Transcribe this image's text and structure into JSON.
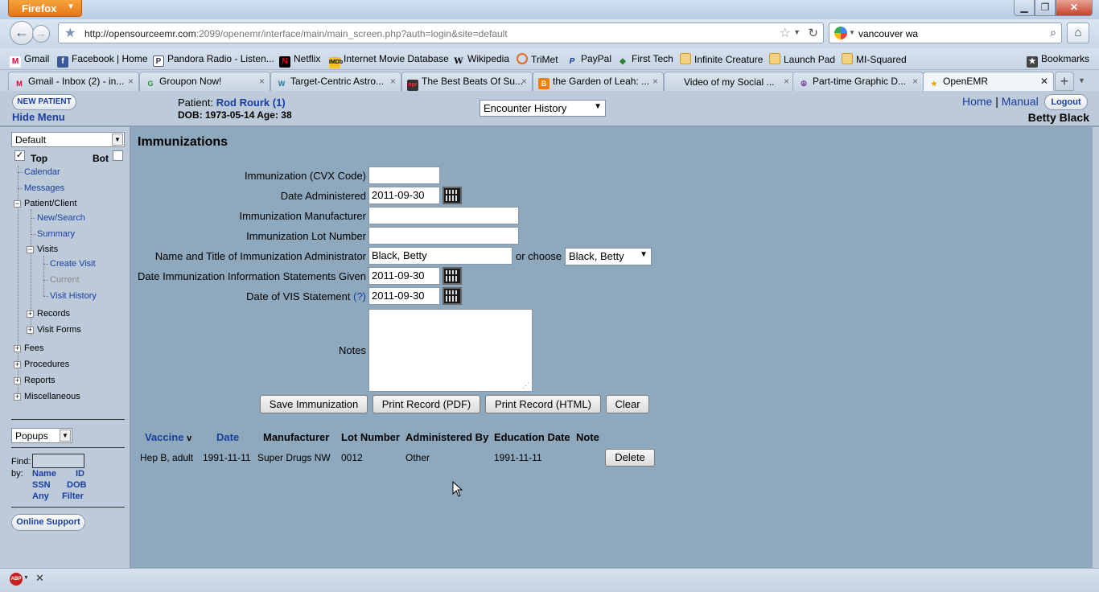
{
  "browser": {
    "app_button": "Firefox",
    "url_host": "http://opensourceemr.com",
    "url_rest": ":2099/openemr/interface/main/main_screen.php?auth=login&site=default",
    "search_value": "vancouver wa",
    "bookmarks": [
      "Gmail",
      "Facebook | Home",
      "Pandora Radio - Listen...",
      "Netflix",
      "Internet Movie Database",
      "Wikipedia",
      "TriMet",
      "PayPal",
      "First Tech",
      "Infinite Creature",
      "Launch Pad",
      "MI-Squared"
    ],
    "bookmarks_menu": "Bookmarks",
    "tabs": [
      "Gmail - Inbox (2) - in...",
      "Groupon Now!",
      "Target-Centric Astro...",
      "The Best Beats Of Su...",
      "the Garden of Leah: ...",
      "Video of my Social ...",
      "Part-time Graphic D...",
      "OpenEMR"
    ]
  },
  "header": {
    "new_patient": "NEW PATIENT",
    "hide_menu": "Hide Menu",
    "patient_label": "Patient:",
    "patient_name": "Rod Rourk (1)",
    "dob_line": "DOB: 1973-05-14 Age: 38",
    "encounter_select": "Encounter History",
    "home": "Home",
    "separator": "|",
    "manual": "Manual",
    "logout": "Logout",
    "user": "Betty Black"
  },
  "sidebar": {
    "view_select": "Default",
    "top": "Top",
    "bot": "Bot",
    "calendar": "Calendar",
    "messages": "Messages",
    "patient_client": "Patient/Client",
    "new_search": "New/Search",
    "summary": "Summary",
    "visits": "Visits",
    "create_visit": "Create Visit",
    "current": "Current",
    "visit_history": "Visit History",
    "records": "Records",
    "visit_forms": "Visit Forms",
    "fees": "Fees",
    "procedures": "Procedures",
    "reports": "Reports",
    "miscellaneous": "Miscellaneous",
    "popups": "Popups",
    "find": "Find:",
    "by": "by:",
    "find_name": "Name",
    "find_id": "ID",
    "find_ssn": "SSN",
    "find_dob": "DOB",
    "find_any": "Any",
    "find_filter": "Filter",
    "online_support": "Online Support"
  },
  "form": {
    "title": "Immunizations",
    "cvx_label": "Immunization (CVX Code)",
    "cvx_value": "",
    "date_admin_label": "Date Administered",
    "date_admin_value": "2011-09-30",
    "manufacturer_label": "Immunization Manufacturer",
    "manufacturer_value": "",
    "lot_label": "Immunization Lot Number",
    "lot_value": "",
    "admin_label": "Name and Title of Immunization Administrator",
    "admin_value": "Black, Betty",
    "or_choose": "or choose",
    "admin_select": "Black, Betty",
    "dis_label": "Date Immunization Information Statements Given",
    "dis_value": "2011-09-30",
    "vis_label": "Date of VIS Statement",
    "vis_help": "(?)",
    "vis_value": "2011-09-30",
    "notes_label": "Notes",
    "save": "Save Immunization",
    "print_pdf": "Print Record (PDF)",
    "print_html": "Print Record (HTML)",
    "clear": "Clear"
  },
  "table": {
    "headers": {
      "vaccine": "Vaccine",
      "sort": "v",
      "date": "Date",
      "manufacturer": "Manufacturer",
      "lot": "Lot Number",
      "administered_by": "Administered By",
      "education_date": "Education Date",
      "note": "Note"
    },
    "rows": [
      {
        "vaccine": "Hep B, adult",
        "date": "1991-11-11",
        "manufacturer": "Super Drugs NW",
        "lot": "0012",
        "administered_by": "Other",
        "education_date": "1991-11-11",
        "note": "",
        "action": "Delete"
      }
    ]
  }
}
